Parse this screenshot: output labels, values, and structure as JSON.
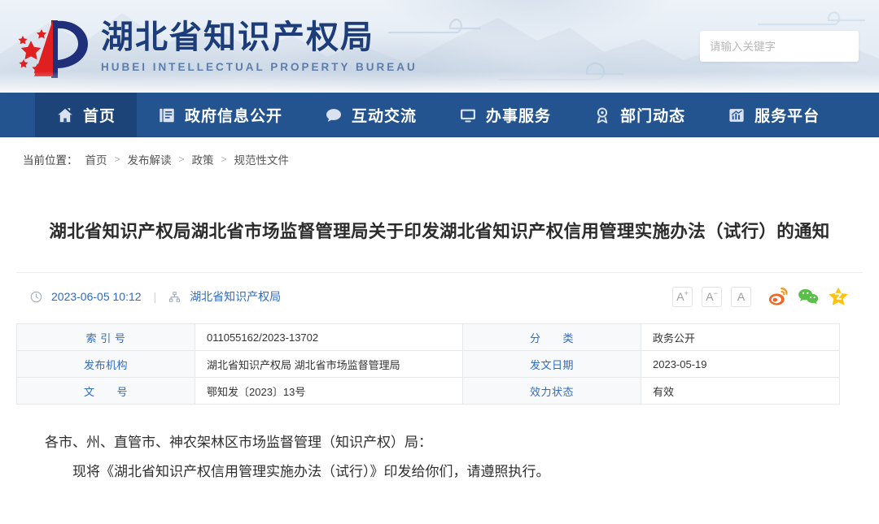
{
  "site": {
    "brand_cn": "湖北省知识产权局",
    "brand_en": "HUBEI INTELLECTUAL PROPERTY BUREAU",
    "logo_name": "hubei-ipb-logo"
  },
  "search": {
    "placeholder": "请输入关键字",
    "value": "",
    "button_icon": "search-icon"
  },
  "nav": {
    "items": [
      {
        "label": "首页",
        "icon": "home-icon",
        "active": true
      },
      {
        "label": "政府信息公开",
        "icon": "document-icon",
        "active": false
      },
      {
        "label": "互动交流",
        "icon": "chat-bubble-icon",
        "active": false
      },
      {
        "label": "办事服务",
        "icon": "monitor-icon",
        "active": false
      },
      {
        "label": "部门动态",
        "icon": "award-icon",
        "active": false
      },
      {
        "label": "服务平台",
        "icon": "chart-icon",
        "active": false
      }
    ]
  },
  "breadcrumb": {
    "label": "当前位置：",
    "separator": ">",
    "items": [
      "首页",
      "发布解读",
      "政策",
      "规范性文件"
    ]
  },
  "article": {
    "title": "湖北省知识产权局湖北省市场监督管理局关于印发湖北省知识产权信用管理实施办法（试行）的通知",
    "publish_datetime": "2023-06-05 10:12",
    "source": "湖北省知识产权局",
    "meta_divider": "|",
    "clock_icon": "clock-icon",
    "source_icon": "sitemap-icon"
  },
  "font_controls": [
    {
      "label": "A",
      "sup": "+",
      "name": "font-increase-button"
    },
    {
      "label": "A",
      "sup": "−",
      "name": "font-decrease-button"
    },
    {
      "label": "A",
      "sup": "",
      "name": "font-default-button"
    }
  ],
  "share": [
    {
      "name": "weibo-share-icon",
      "color": "#f26522"
    },
    {
      "name": "wechat-share-icon",
      "color": "#5cbe4a"
    },
    {
      "name": "favorite-star-icon",
      "color": "#ffc20e"
    }
  ],
  "info_table": {
    "rows": [
      {
        "l1": "索  引  号",
        "v1": "011055162/2023-13702",
        "l2": "分　　类",
        "v2": "政务公开"
      },
      {
        "l1": "发布机构",
        "v1": "湖北省知识产权局 湖北省市场监督管理局",
        "l2": "发文日期",
        "v2": "2023-05-19"
      },
      {
        "l1": "文　　号",
        "v1": "鄂知发〔2023〕13号",
        "l2": "效力状态",
        "v2": "有效"
      }
    ]
  },
  "content": {
    "paragraphs": [
      {
        "text": "各市、州、直管市、神农架林区市场监督管理（知识产权）局：",
        "indent": false
      },
      {
        "text": "现将《湖北省知识产权信用管理实施办法（试行）》印发给你们，请遵照执行。",
        "indent": true
      }
    ]
  },
  "colors": {
    "nav_bg": "#24548f",
    "nav_active_bg": "#1d4479",
    "accent_blue": "#2f6bbf",
    "brand_blue": "#1c3d7a",
    "search_btn": "#f39c2a"
  }
}
